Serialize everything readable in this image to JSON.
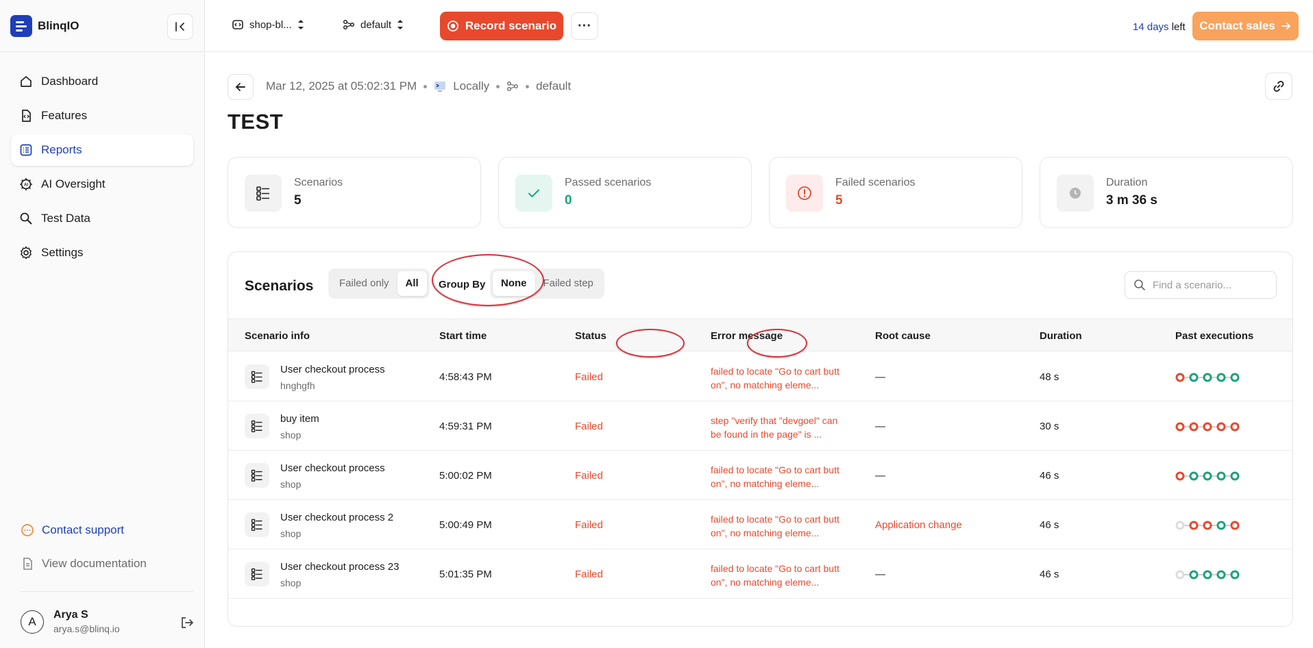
{
  "brand": {
    "name": "BlinqIO"
  },
  "nav": [
    {
      "label": "Dashboard",
      "icon": "home-icon"
    },
    {
      "label": "Features",
      "icon": "file-code-icon"
    },
    {
      "label": "Reports",
      "icon": "list-icon"
    },
    {
      "label": "AI Oversight",
      "icon": "ai-gear-icon"
    },
    {
      "label": "Test Data",
      "icon": "data-search-icon"
    },
    {
      "label": "Settings",
      "icon": "gear-icon"
    }
  ],
  "sidebar_footer": {
    "support": "Contact support",
    "docs": "View documentation"
  },
  "user": {
    "name": "Arya S",
    "email": "arya.s@blinq.io",
    "initial": "A"
  },
  "topbar": {
    "project": "shop-bl...",
    "environment": "default",
    "record": "Record scenario",
    "trial_days": "14 days",
    "trial_suffix": " left",
    "contact_sales": "Contact sales"
  },
  "report": {
    "date": "Mar 12, 2025 at 05:02:31 PM",
    "location": "Locally",
    "environment": "default",
    "title": "TEST"
  },
  "cards": [
    {
      "label": "Scenarios",
      "value": "5"
    },
    {
      "label": "Passed scenarios",
      "value": "0"
    },
    {
      "label": "Failed scenarios",
      "value": "5"
    },
    {
      "label": "Duration",
      "value": "3 m 36 s"
    }
  ],
  "panel": {
    "title": "Scenarios",
    "filter": [
      "Failed only",
      "All"
    ],
    "groupby_label": "Group By",
    "groupby": [
      "None",
      "Failed step"
    ],
    "search_placeholder": "Find a scenario..."
  },
  "columns": [
    "Scenario info",
    "Start time",
    "Status",
    "Error message",
    "Root cause",
    "Duration",
    "Past executions"
  ],
  "colors": {
    "failed": "#e8492c",
    "passed": "#1aa37a",
    "empty": "#dcdcdc",
    "accent": "#1f3fb8"
  },
  "rows": [
    {
      "name": "User checkout process",
      "feature": "hnghgfh",
      "start": "4:58:43 PM",
      "status": "Failed",
      "error": "failed to locate \"Go to cart button\", no matching eleme...",
      "root_cause": "—",
      "duration": "48 s",
      "past": [
        "failed",
        "passed",
        "passed",
        "passed",
        "passed"
      ]
    },
    {
      "name": "buy item",
      "feature": "shop",
      "start": "4:59:31 PM",
      "status": "Failed",
      "error": "step \"verify that \"devgoel\" can be found in the page\" is ...",
      "root_cause": "—",
      "duration": "30 s",
      "past": [
        "failed",
        "failed",
        "failed",
        "failed",
        "failed"
      ]
    },
    {
      "name": "User checkout process",
      "feature": "shop",
      "start": "5:00:02 PM",
      "status": "Failed",
      "error": "failed to locate \"Go to cart button\", no matching eleme...",
      "root_cause": "—",
      "duration": "46 s",
      "past": [
        "failed",
        "passed",
        "passed",
        "passed",
        "passed"
      ]
    },
    {
      "name": "User checkout process 2",
      "feature": "shop",
      "start": "5:00:49 PM",
      "status": "Failed",
      "error": "failed to locate \"Go to cart button\", no matching eleme...",
      "root_cause": "Application change",
      "duration": "46 s",
      "past": [
        "empty",
        "failed",
        "failed",
        "passed",
        "failed"
      ]
    },
    {
      "name": "User checkout process 23",
      "feature": "shop",
      "start": "5:01:35 PM",
      "status": "Failed",
      "error": "failed to locate \"Go to cart button\", no matching eleme...",
      "root_cause": "—",
      "duration": "46 s",
      "past": [
        "empty",
        "passed",
        "passed",
        "passed",
        "passed"
      ]
    }
  ]
}
